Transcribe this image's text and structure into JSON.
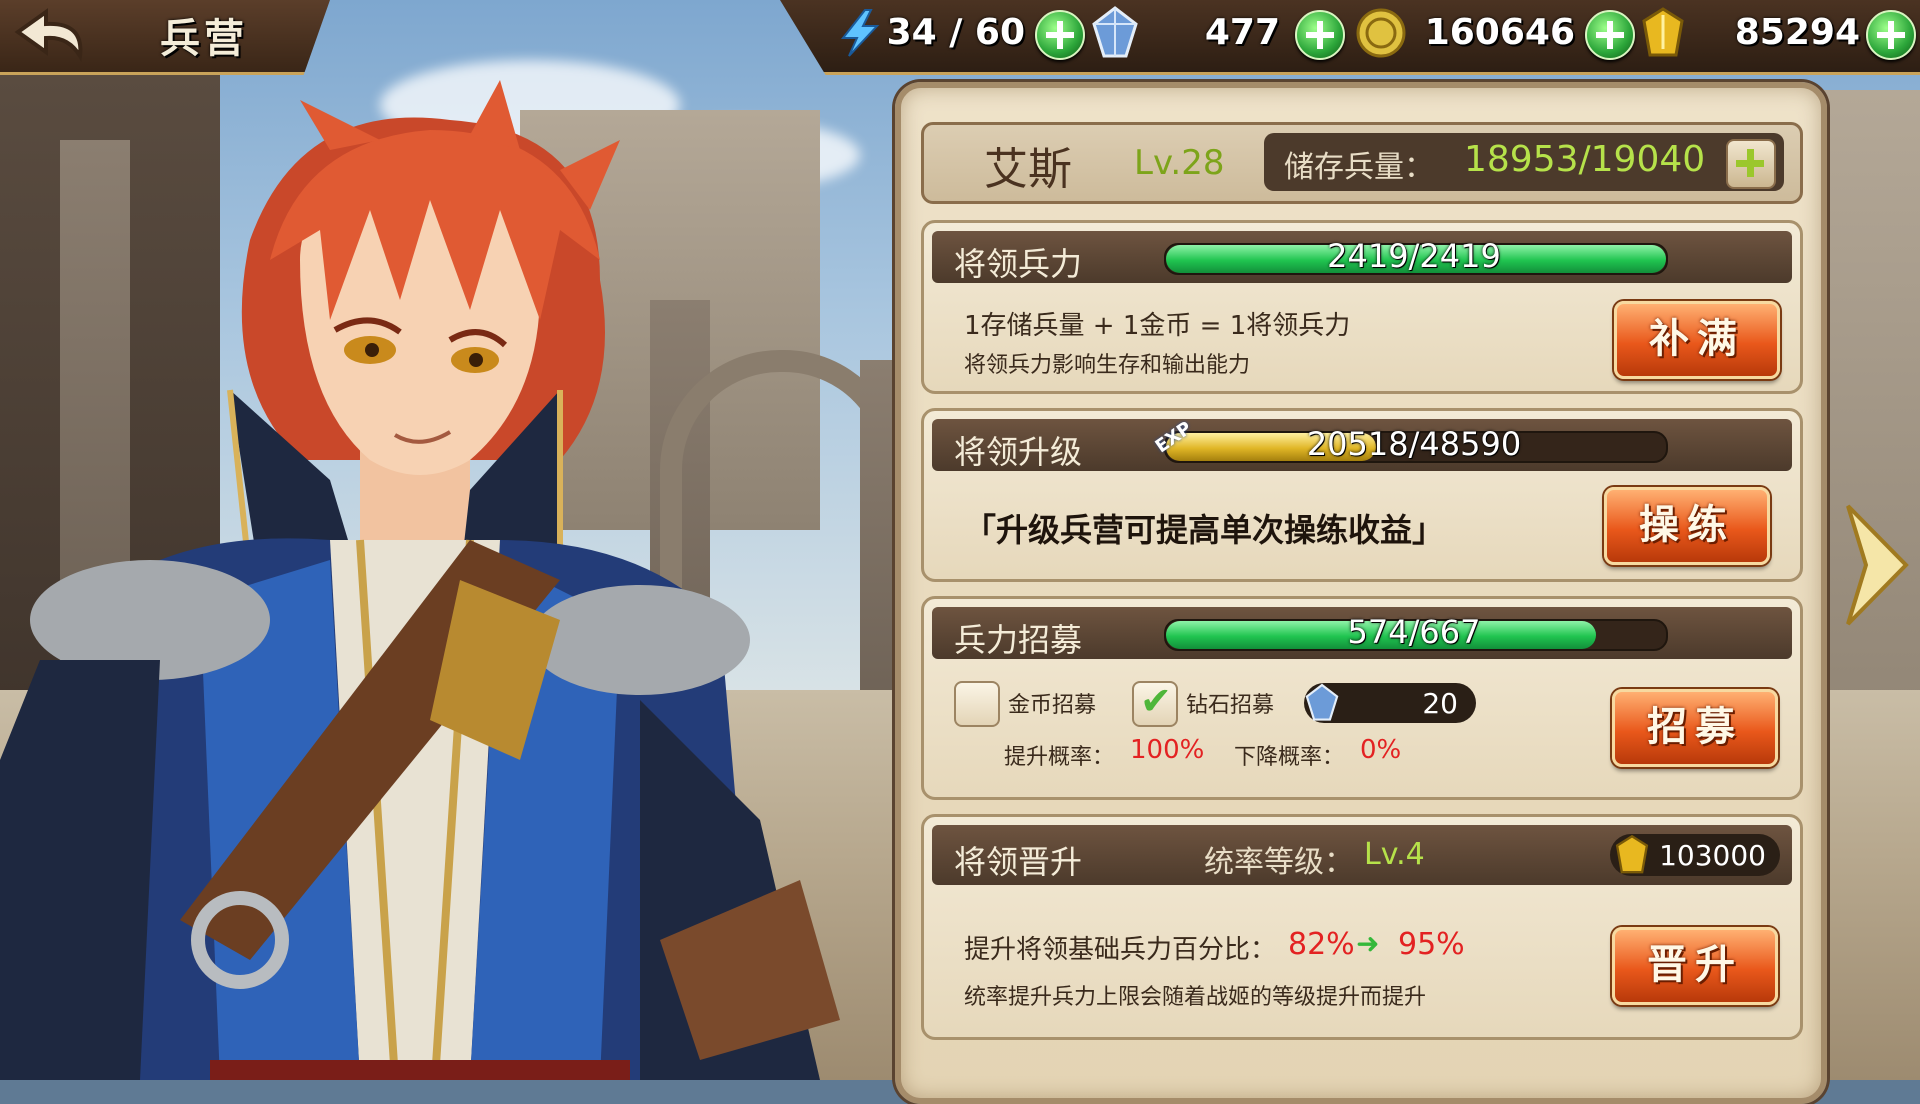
{
  "topbar": {
    "title": "兵营",
    "resources": {
      "energy": "34 / 60",
      "diamond": "477",
      "coin": "160646",
      "gold": "85294"
    }
  },
  "hero": {
    "name": "艾斯",
    "level": "Lv.28",
    "store_label": "储存兵量：",
    "store_value": "18953/19040"
  },
  "troops": {
    "title": "将领兵力",
    "bar_text": "2419/2419",
    "fill": 1.0,
    "formula": "1存储兵量 + 1金币 = 1将领兵力",
    "note": "将领兵力影响生存和输出能力",
    "button": "补满"
  },
  "upgrade": {
    "title": "将领升级",
    "exp_tag": "EXP",
    "bar_text": "20518/48590",
    "fill": 0.42,
    "quote": "「升级兵营可提高单次操练收益」",
    "button": "操练"
  },
  "recruit": {
    "title": "兵力招募",
    "bar_text": "574/667",
    "fill": 0.86,
    "gold_label": "金币招募",
    "gold_checked": false,
    "diamond_label": "钻石招募",
    "diamond_checked": true,
    "diamond_cost": "20",
    "up_label": "提升概率：",
    "up_value": "100%",
    "down_label": "下降概率：",
    "down_value": "0%",
    "button": "招募"
  },
  "promote": {
    "title": "将领晋升",
    "lead_label": "统率等级：",
    "lead_value": "Lv.4",
    "gold_cost": "103000",
    "pct_label": "提升将领基础兵力百分比：",
    "pct_from": "82%",
    "pct_to": "95%",
    "note": "统率提升兵力上限会随着战姬的等级提升而提升",
    "button": "晋升"
  },
  "colors": {
    "accent_green": "#b6e24a",
    "bar_green": "#20c450",
    "bar_gold": "#e0b626",
    "button_orange": "#e9581b",
    "rate_red": "#e32222",
    "panel_bg": "#eee2c9"
  }
}
